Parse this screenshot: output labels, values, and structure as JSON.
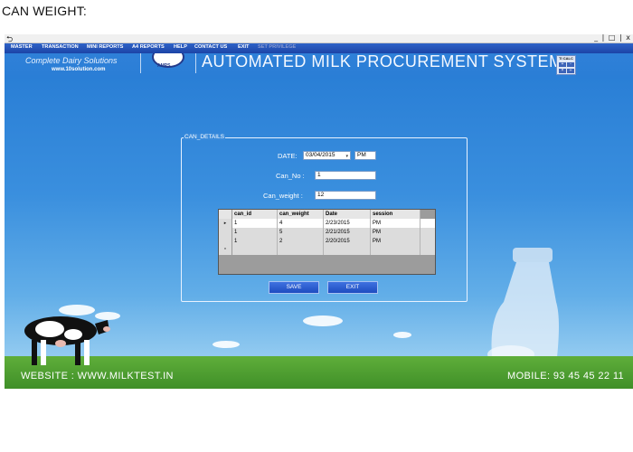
{
  "document": {
    "heading": "CAN WEIGHT:"
  },
  "window": {
    "controls": "_ | □ | x"
  },
  "menu": {
    "items": [
      {
        "label": "MASTER",
        "enabled": true
      },
      {
        "label": "TRANSACTION",
        "enabled": true
      },
      {
        "label": "MINI REPORTS",
        "enabled": true
      },
      {
        "label": "A4 REPORTS",
        "enabled": true
      },
      {
        "label": "HELP",
        "enabled": true
      },
      {
        "label": "CONTACT US",
        "enabled": true
      },
      {
        "label": "EXIT",
        "enabled": true
      },
      {
        "label": "SET PRIVILEGE",
        "enabled": false
      }
    ]
  },
  "header": {
    "tagline": "Complete Dairy Solutions",
    "website": "www.10solution.com",
    "logo_text": "AMPS",
    "title": "AUTOMATED MILK PROCUREMENT SYSTEM",
    "calc_label": "TI CALC",
    "calc_keys": [
      "+",
      "-",
      "×",
      "÷"
    ]
  },
  "form": {
    "legend": "CAN_DETAILS",
    "date": {
      "label": "DATE:",
      "value": "03/04/2015",
      "session": "PM"
    },
    "can_no": {
      "label": "Can_No :",
      "value": "1"
    },
    "can_weight": {
      "label": "Can_weight :",
      "value": "12"
    }
  },
  "grid": {
    "columns": [
      "can_id",
      "can_weight",
      "Date",
      "session"
    ],
    "rows": [
      {
        "marker": "▸",
        "cells": [
          "1",
          "4",
          "2/23/2015",
          "PM"
        ]
      },
      {
        "marker": "",
        "cells": [
          "1",
          "5",
          "2/21/2015",
          "PM"
        ]
      },
      {
        "marker": "",
        "cells": [
          "1",
          "2",
          "2/20/2015",
          "PM"
        ]
      },
      {
        "marker": "*",
        "cells": [
          "",
          "",
          "",
          ""
        ]
      }
    ]
  },
  "buttons": {
    "save": "SAVE",
    "exit": "EXIT"
  },
  "footer": {
    "website": "WEBSITE : WWW.MILKTEST.IN",
    "mobile": "MOBILE: 93 45 45 22 11"
  },
  "colors": {
    "menu_bar": "#2f63c8",
    "sky": "#2a86d6",
    "button": "#2a5cd0",
    "grass": "#4f9e32"
  }
}
